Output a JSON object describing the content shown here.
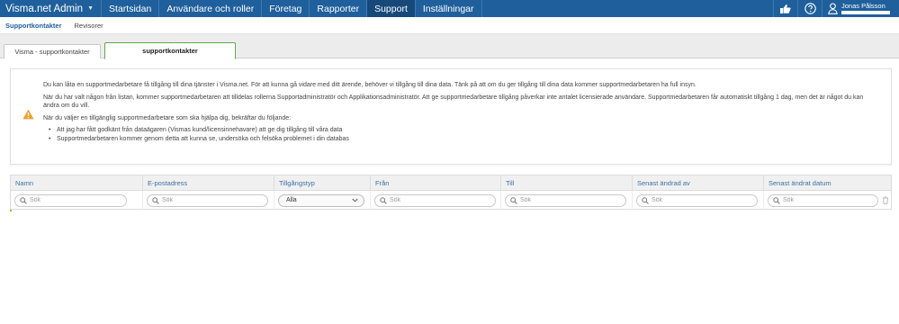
{
  "app": {
    "title": "Visma.net Admin"
  },
  "nav": [
    {
      "label": "Startsidan",
      "active": false
    },
    {
      "label": "Användare och roller",
      "active": false
    },
    {
      "label": "Företag",
      "active": false
    },
    {
      "label": "Rapporter",
      "active": false
    },
    {
      "label": "Support",
      "active": true
    },
    {
      "label": "Inställningar",
      "active": false
    }
  ],
  "user": {
    "name": "Jonas Pålsson"
  },
  "subnav": [
    {
      "label": "Supportkontakter",
      "active": true
    },
    {
      "label": "Revisorer",
      "active": false
    }
  ],
  "tabs": [
    {
      "label": "Visma - supportkontakter",
      "active": false
    },
    {
      "label": "supportkontakter",
      "active": true
    }
  ],
  "info": {
    "p1": "Du kan låta en supportmedarbetare få tillgång till dina tjänster i Visma.net. För att kunna gå vidare med ditt ärende, behöver vi tillgång till dina data. Tänk på att om du ger tillgång till dina data kommer supportmedarbetaren ha full insyn.",
    "p2": "När du har valt någon från listan, kommer supportmedarbetaren att tilldelas rollerna Supportadministratör och Applikationsadministratör. Att ge supportmedarbetare tillgång påverkar inte antalet licensierade användare. Supportmedarbetaren får automatiskt tillgång 1 dag, men det är något du kan ändra om du vill.",
    "p3": "När du väljer en tillgänglig supportmedarbetare som ska hjälpa dig, bekräftar du följande:",
    "bullets": [
      "Att jag har fått godkänt från dataägaren (Vismas kund/licensinnehavare) att ge dig tillgång till våra data",
      "Supportmedarbetaren kommer genom detta att kunna se, undersöka och felsöka problemet i din databas"
    ]
  },
  "table": {
    "columns": [
      "Namn",
      "E-postadress",
      "Tillgångstyp",
      "Från",
      "Till",
      "Senast ändrad av",
      "Senast ändrat datum"
    ],
    "search_placeholder": "Sök",
    "access_type_selected": "Alla"
  },
  "colors": {
    "nav_bg": "#1f5f9c",
    "nav_active": "#16497a",
    "active_tab_border": "#5fa84a",
    "warning": "#f0a030",
    "header_text": "#3b6fa6"
  }
}
